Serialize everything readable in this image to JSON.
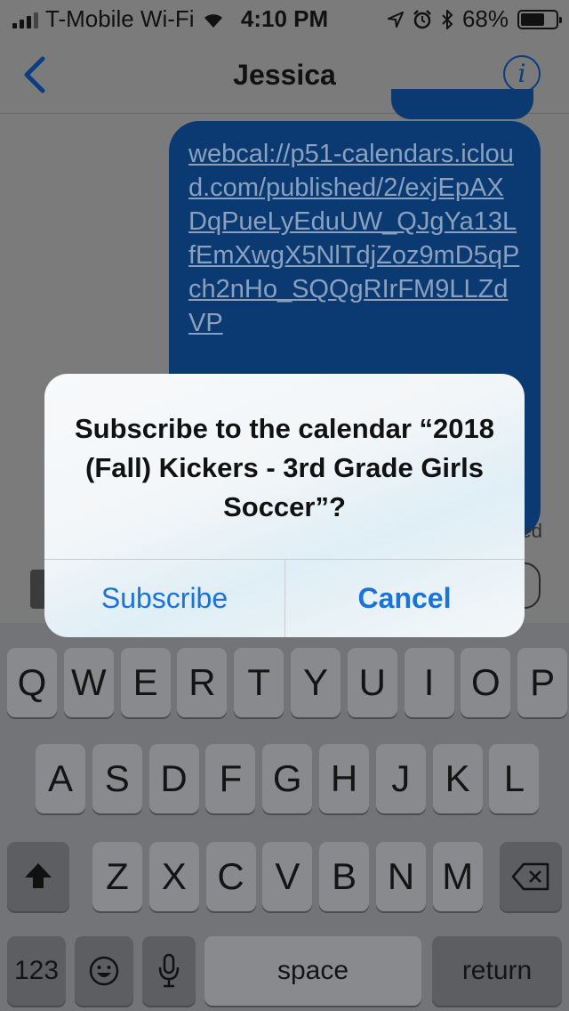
{
  "status_bar": {
    "carrier": "T-Mobile Wi-Fi",
    "time": "4:10 PM",
    "battery_percent": "68%",
    "battery_level": 0.68,
    "icons": [
      "signal-icon",
      "wifi-icon",
      "location-icon",
      "alarm-icon",
      "bluetooth-icon",
      "battery-icon"
    ]
  },
  "nav": {
    "title": "Jessica",
    "back_icon": "chevron-left-icon",
    "info_icon": "info-icon",
    "info_glyph": "i"
  },
  "conversation": {
    "message_text": "webcal://p51-calendars.icloud.com/published/2/exjEpAXDqPueLyEduUW_QJgYa13LfEmXwgX5NlTdjZoz9mD5qPch2nHo_SQQgRIrFM9LLZdVP",
    "delivered_fragment": "ed"
  },
  "alert": {
    "message": "Subscribe to the calendar “2018 (Fall) Kickers - 3rd Grade Girls Soccer”?",
    "subscribe_label": "Subscribe",
    "cancel_label": "Cancel",
    "accent": "#1a73d9"
  },
  "keyboard": {
    "row1": [
      "Q",
      "W",
      "E",
      "R",
      "T",
      "Y",
      "U",
      "I",
      "O",
      "P"
    ],
    "row2": [
      "A",
      "S",
      "D",
      "F",
      "G",
      "H",
      "J",
      "K",
      "L"
    ],
    "row3": [
      "Z",
      "X",
      "C",
      "V",
      "B",
      "N",
      "M"
    ],
    "numbers_label": "123",
    "space_label": "space",
    "return_label": "return",
    "shift_icon": "shift-icon",
    "delete_icon": "delete-icon",
    "emoji_icon": "emoji-icon",
    "mic_icon": "microphone-icon"
  }
}
